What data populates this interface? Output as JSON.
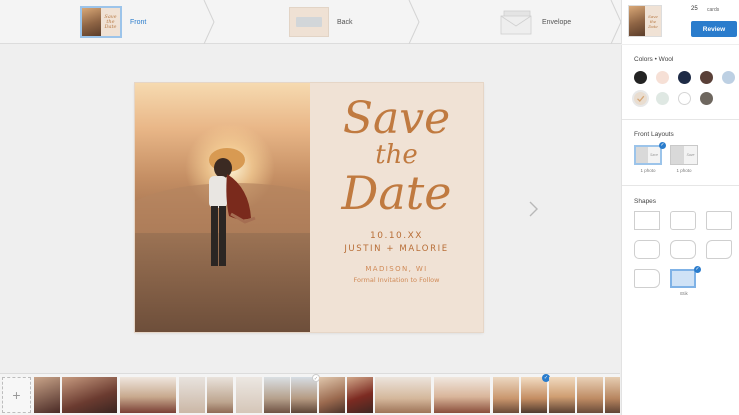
{
  "steps": [
    {
      "label": "Front",
      "active": true
    },
    {
      "label": "Back",
      "active": false
    },
    {
      "label": "Envelope",
      "active": false
    }
  ],
  "order": {
    "quantity": "25",
    "quantity_unit": "cards",
    "review_label": "Review"
  },
  "card": {
    "script_line1": "Save",
    "script_line2": "the",
    "script_line3": "Date",
    "date": "10.10.XX",
    "names": "JUSTIN + MALORIE",
    "place": "MADISON, WI",
    "formal": "Formal Invitation to Follow"
  },
  "panel": {
    "colors_title": "Colors • Wool",
    "colors": [
      {
        "name": "black",
        "hex": "#232323"
      },
      {
        "name": "blush",
        "hex": "#f6e0d6"
      },
      {
        "name": "navy",
        "hex": "#1e2b46"
      },
      {
        "name": "brown",
        "hex": "#5a4038"
      },
      {
        "name": "light-blue",
        "hex": "#bdd0e3"
      },
      {
        "name": "tan",
        "hex": "#e9ddd0",
        "selected": true
      },
      {
        "name": "mint",
        "hex": "#dfe8e3"
      },
      {
        "name": "white",
        "hex": "#ffffff"
      },
      {
        "name": "taupe",
        "hex": "#6e675f"
      }
    ],
    "layouts_title": "Front Layouts",
    "layouts": [
      {
        "caption": "1 photo",
        "selected": true
      },
      {
        "caption": "1 photo",
        "selected": false
      }
    ],
    "shapes_title": "Shapes",
    "selected_shape_caption": "Etik"
  },
  "strip": {
    "add_label": "+"
  },
  "accent": "#2a7ccc"
}
